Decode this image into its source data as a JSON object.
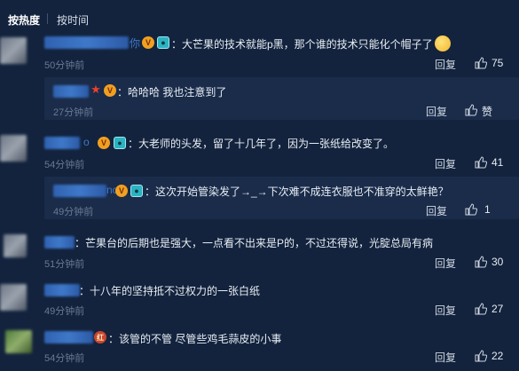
{
  "sort": {
    "hot_label": "按热度",
    "time_label": "按时间"
  },
  "comments": [
    {
      "text": "：大芒果的技术就能p黑，那个谁的技术只能化个帽子了",
      "username_fragment": "你",
      "time": "50分钟前",
      "reply": "回复",
      "likes": "75"
    },
    {
      "text": "：哈哈哈 我也注意到了",
      "time": "27分钟前",
      "reply": "回复",
      "likes": "赞"
    },
    {
      "text": "：大老师的头发，留了十几年了，因为一张纸给改变了。",
      "username_fragment": "o",
      "time": "54分钟前",
      "reply": "回复",
      "likes": "41"
    },
    {
      "text": "：这次开始管染发了→_→下次难不成连衣服也不准穿的太鲜艳？",
      "username_fragment": "no",
      "time": "49分钟前",
      "reply": "回复",
      "likes": "1"
    },
    {
      "text": "：芒果台的后期也是强大，一点看不出来是P的，不过还得说，光腚总局有病",
      "time": "51分钟前",
      "reply": "回复",
      "likes": "30"
    },
    {
      "text": "：十八年的坚持抵不过权力的一张白纸",
      "time": "49分钟前",
      "reply": "回复",
      "likes": "27"
    },
    {
      "text": "：该管的不管 尽管些鸡毛蒜皮的小事",
      "badge_text": "红",
      "time": "54分钟前",
      "reply": "回复",
      "likes": "22"
    }
  ],
  "colors": {
    "background": "#13233d",
    "sub_reply_bg": "#1a2c4a",
    "username": "#3f78c9",
    "muted": "#6a7a93"
  }
}
